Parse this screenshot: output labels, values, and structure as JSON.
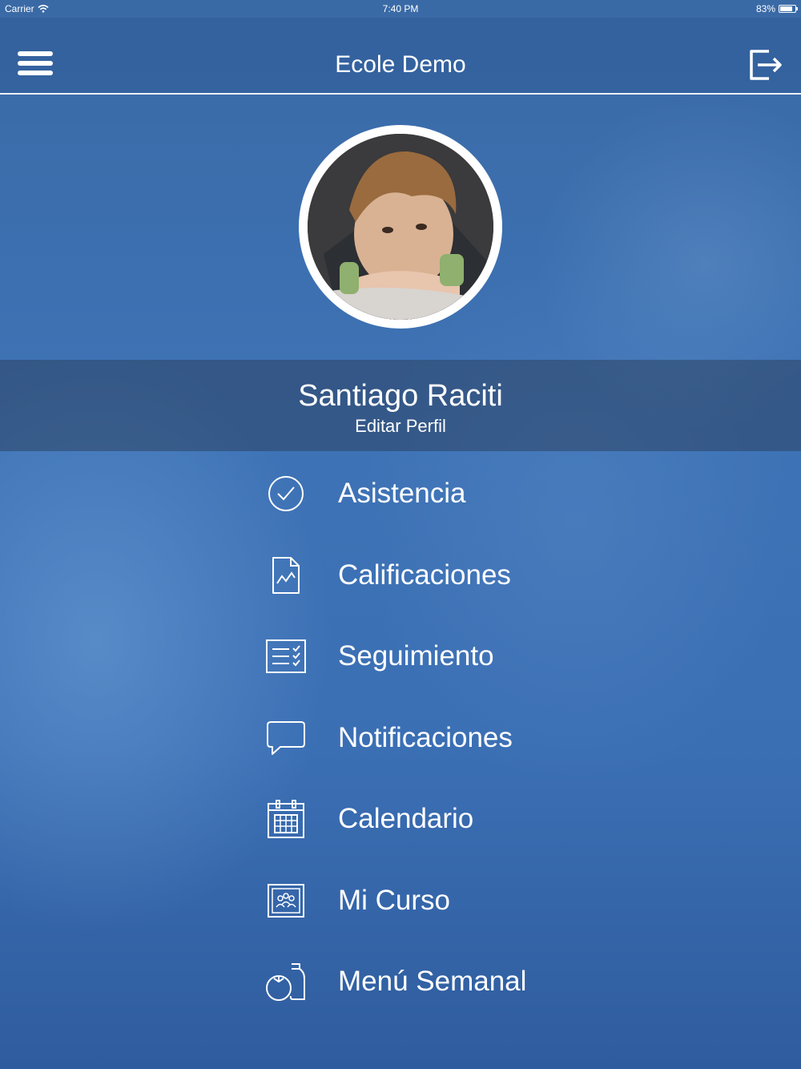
{
  "status_bar": {
    "carrier": "Carrier",
    "time": "7:40 PM",
    "battery": "83%",
    "battery_level": 0.83
  },
  "header": {
    "title": "Ecole Demo",
    "menu_icon": "hamburger-icon",
    "logout_icon": "logout-icon"
  },
  "profile": {
    "name": "Santiago Raciti",
    "edit_label": "Editar Perfil"
  },
  "menu": {
    "items": [
      {
        "label": "Asistencia",
        "icon": "check-circle-icon"
      },
      {
        "label": "Calificaciones",
        "icon": "grade-document-icon"
      },
      {
        "label": "Seguimiento",
        "icon": "checklist-icon"
      },
      {
        "label": "Notificaciones",
        "icon": "speech-bubble-icon"
      },
      {
        "label": "Calendario",
        "icon": "calendar-icon"
      },
      {
        "label": "Mi Curso",
        "icon": "classroom-icon"
      },
      {
        "label": "Menú Semanal",
        "icon": "food-icon"
      }
    ]
  }
}
